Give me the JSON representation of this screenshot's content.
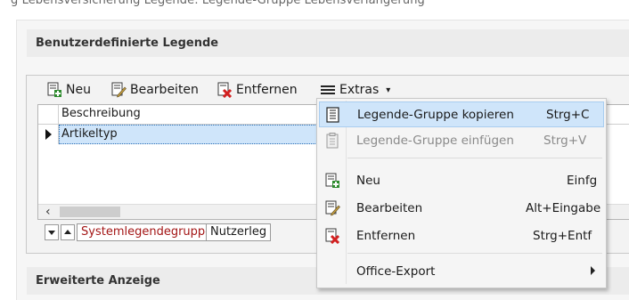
{
  "top_strip_text": "g Lebensversicherung  Legende: Legende-Gruppe Lebensverlängerung",
  "section1": {
    "title": "Benutzerdefinierte Legende"
  },
  "section2": {
    "title": "Erweiterte Anzeige"
  },
  "toolbar": {
    "new_label": "Neu",
    "edit_label": "Bearbeiten",
    "remove_label": "Entfernen",
    "extras_label": "Extras",
    "extras_arrow": "▾"
  },
  "grid": {
    "column_header": "Beschreibung",
    "rows": [
      {
        "label": "Artikeltyp"
      }
    ]
  },
  "bottom_tabs": {
    "system_tab": "Systemlegendegruppe",
    "user_tab": "Nutzerleg"
  },
  "menu": {
    "items": [
      {
        "label": "Legende-Gruppe kopieren",
        "shortcut": "Strg+C",
        "icon": "copy-icon",
        "state": "selected"
      },
      {
        "label": "Legende-Gruppe einfügen",
        "shortcut": "Strg+V",
        "icon": "paste-icon",
        "state": "disabled"
      },
      {
        "label": "Neu",
        "shortcut": "Einfg",
        "icon": "new-icon",
        "state": "normal"
      },
      {
        "label": "Bearbeiten",
        "shortcut": "Alt+Eingabe",
        "icon": "edit-icon",
        "state": "normal"
      },
      {
        "label": "Entfernen",
        "shortcut": "Strg+Entf",
        "icon": "remove-icon",
        "state": "normal"
      },
      {
        "label": "Office-Export",
        "shortcut": "",
        "icon": "",
        "state": "submenu"
      }
    ]
  },
  "colors": {
    "selection": "#cfe5fa",
    "system_tab_text": "#a31515",
    "accent_green": "#2e8b2e",
    "accent_red": "#d22020"
  }
}
